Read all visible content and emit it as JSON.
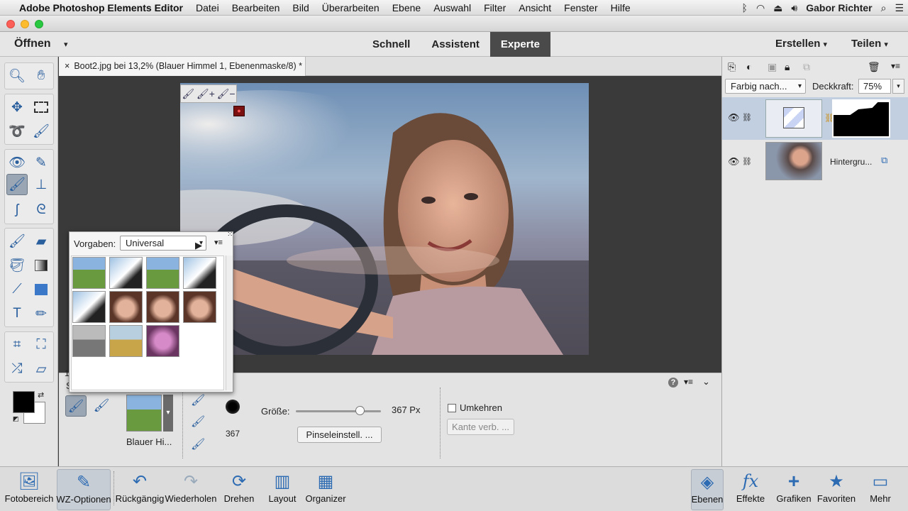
{
  "menubar": {
    "app_name": "Adobe Photoshop Elements Editor",
    "items": [
      "Datei",
      "Bearbeiten",
      "Bild",
      "Überarbeiten",
      "Ebene",
      "Auswahl",
      "Filter",
      "Ansicht",
      "Fenster",
      "Hilfe"
    ],
    "user": "Gabor Richter"
  },
  "header": {
    "open_label": "Öffnen",
    "modes": [
      "Schnell",
      "Assistent",
      "Experte"
    ],
    "active_mode": "Experte",
    "create_label": "Erstellen",
    "share_label": "Teilen"
  },
  "document": {
    "tab_title": "Boot2.jpg bei 13,2% (Blauer Himmel 1, Ebenenmaske/8) *",
    "close_glyph": "×",
    "status_left": "13"
  },
  "presets": {
    "label": "Vorgaben:",
    "selected": "Universal",
    "items": [
      "tree-field",
      "wedding-couple",
      "tree-field",
      "wedding-couple",
      "wedding-couple",
      "smiling-woman",
      "smiling-woman",
      "smiling-woman",
      "bw-tree",
      "church",
      "pink-rose"
    ]
  },
  "options": {
    "s_label": "S",
    "preset_name": "Blauer Hi...",
    "size_label": "Größe:",
    "size_value": "367 Px",
    "size_slider_fraction": 0.75,
    "brush_size_number": "367",
    "brush_settings_label": "Pinseleinstell. ...",
    "invert_label": "Umkehren",
    "refine_edge_label": "Kante verb. ...",
    "help_glyph": "?"
  },
  "layers": {
    "blend_mode": "Farbig nach...",
    "opacity_label": "Deckkraft:",
    "opacity_value": "75%",
    "rows": [
      {
        "name": "",
        "selected": true
      },
      {
        "name": "Hintergru...",
        "selected": false
      }
    ]
  },
  "bottombar": {
    "left": [
      {
        "label": "Fotobereich",
        "icon": "photo-bin-icon"
      },
      {
        "label": "WZ-Optionen",
        "icon": "tool-options-icon"
      },
      {
        "label": "Rückgängig",
        "icon": "undo-icon"
      },
      {
        "label": "Wiederholen",
        "icon": "redo-icon"
      },
      {
        "label": "Drehen",
        "icon": "rotate-icon"
      },
      {
        "label": "Layout",
        "icon": "layout-icon"
      },
      {
        "label": "Organizer",
        "icon": "organizer-icon"
      }
    ],
    "right": [
      {
        "label": "Ebenen",
        "icon": "layers-icon"
      },
      {
        "label": "Effekte",
        "icon": "fx-icon"
      },
      {
        "label": "Grafiken",
        "icon": "plus-icon"
      },
      {
        "label": "Favoriten",
        "icon": "star-icon"
      },
      {
        "label": "Mehr",
        "icon": "more-icon"
      }
    ]
  },
  "colors": {
    "accent": "#2d6bb3",
    "active_mode_bg": "#4a4a4a",
    "canvas_bg": "#3a3a3a"
  }
}
